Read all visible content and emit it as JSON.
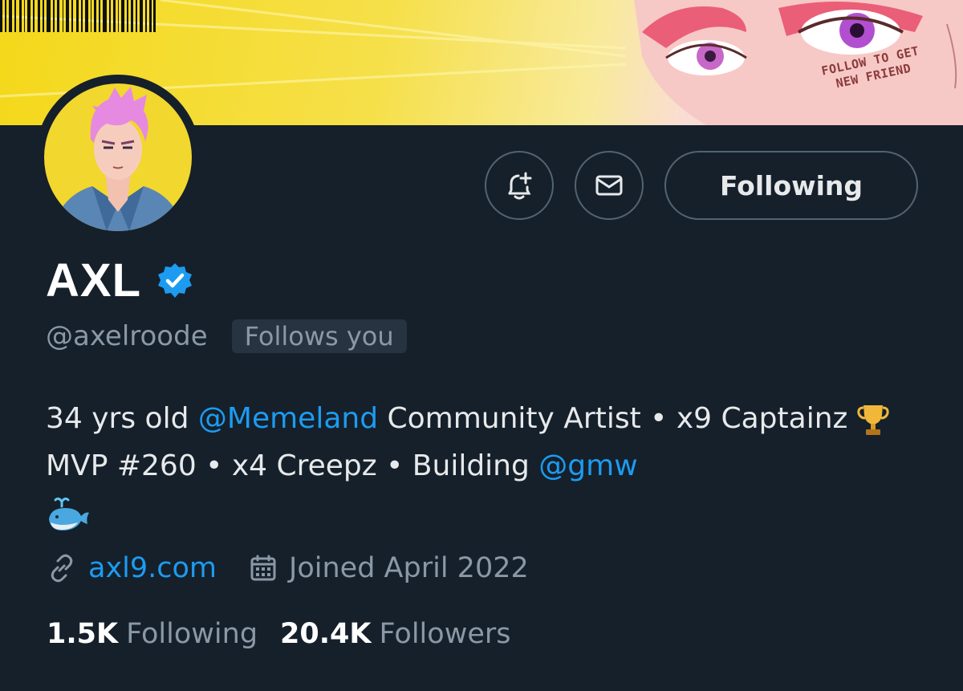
{
  "banner": {
    "stamp_line1": "FOLLOW TO GET",
    "stamp_line2": "NEW FRIEND"
  },
  "profile": {
    "name": "AXL",
    "handle": "@axelroode",
    "follows_you": "Follows you",
    "verified": true
  },
  "actions": {
    "notify_icon": "bell-plus-icon",
    "message_icon": "envelope-icon",
    "follow_label": "Following"
  },
  "bio": {
    "part1": "34 yrs old ",
    "mention1": "@Memeland",
    "part2": " Community Artist • x9 Captainz ",
    "trophy": "🏆",
    "part3": " MVP #260 • x4 Creepz • Building ",
    "mention2": "@gmw",
    "whale": "🐳"
  },
  "meta": {
    "link_icon": "link-icon",
    "website": "axl9.com",
    "calendar_icon": "calendar-icon",
    "joined": "Joined April 2022"
  },
  "stats": {
    "following_count": "1.5K",
    "following_label": "Following",
    "followers_count": "20.4K",
    "followers_label": "Followers"
  },
  "colors": {
    "background": "#15202b",
    "accent": "#1d9bf0",
    "muted": "#8b98a5",
    "banner_yellow": "#f4d81a"
  }
}
